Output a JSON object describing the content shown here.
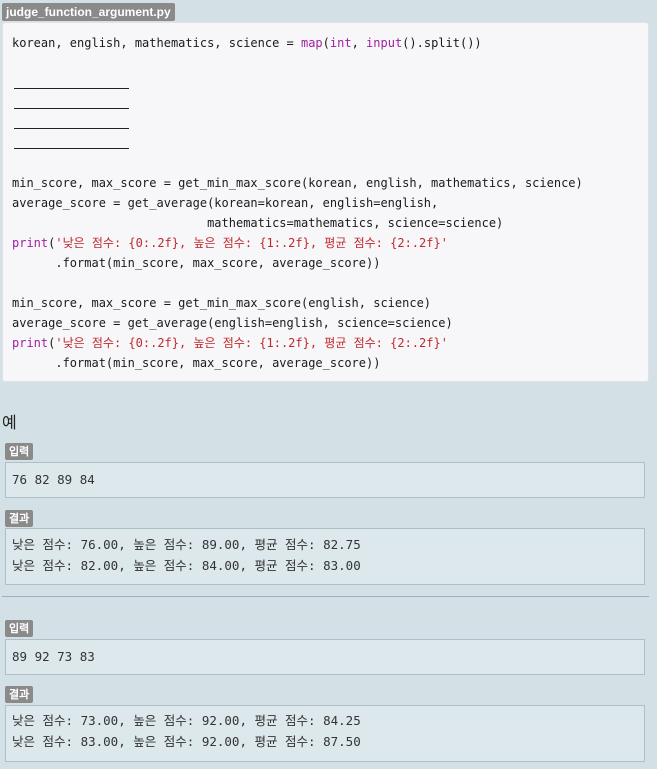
{
  "file_name": "judge_function_argument.py",
  "code": {
    "line1": {
      "a": "korean, english, mathematics, science = ",
      "b": "map",
      "c": "(",
      "d": "int",
      "e": ", ",
      "f": "input",
      "g": "().split())"
    },
    "line_min1": "min_score, max_score = get_min_max_score(korean, english, mathematics, science)",
    "line_avg1a": "average_score = get_average(korean=korean, english=english,",
    "line_avg1b": "                           mathematics=mathematics, science=science)",
    "print1": {
      "fn": "print",
      "open": "(",
      "str": "'낮은 점수: {0:.2f}, 높은 점수: {1:.2f}, 평균 점수: {2:.2f}'"
    },
    "format1": "      .format(min_score, max_score, average_score))",
    "line_min2": "min_score, max_score = get_min_max_score(english, science)",
    "line_avg2": "average_score = get_average(english=english, science=science)",
    "print2": {
      "fn": "print",
      "open": "(",
      "str": "'낮은 점수: {0:.2f}, 높은 점수: {1:.2f}, 평균 점수: {2:.2f}'"
    },
    "format2": "      .format(min_score, max_score, average_score))"
  },
  "example_heading": "예",
  "examples": [
    {
      "input_label": "입력",
      "input": "76 82 89 84",
      "output_label": "결과",
      "output": [
        "낮은 점수: 76.00, 높은 점수: 89.00, 평균 점수: 82.75",
        "낮은 점수: 82.00, 높은 점수: 84.00, 평균 점수: 83.00"
      ]
    },
    {
      "input_label": "입력",
      "input": "89 92 73 83",
      "output_label": "결과",
      "output": [
        "낮은 점수: 73.00, 높은 점수: 92.00, 평균 점수: 84.25",
        "낮은 점수: 83.00, 높은 점수: 92.00, 평균 점수: 87.50"
      ]
    }
  ]
}
